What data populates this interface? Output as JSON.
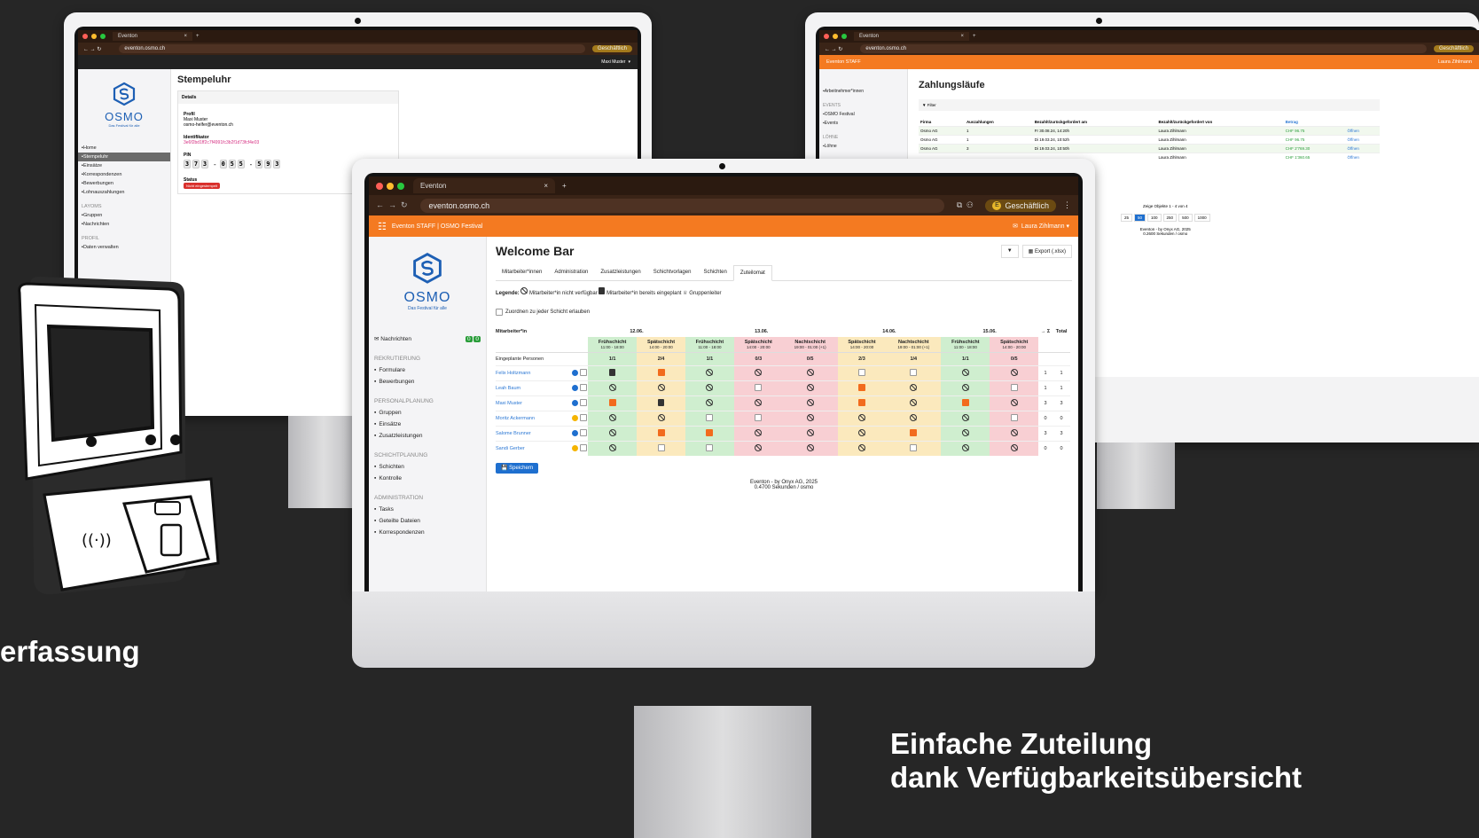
{
  "browser": {
    "tab_title": "Eventon",
    "tab_close": "×",
    "tab_new": "+",
    "url": "eventon.osmo.ch",
    "profile_label": "Geschäftlich",
    "profile_letter": "E"
  },
  "left_screen": {
    "user_menu": "Maxi Muster",
    "logo_text": "OSMO",
    "logo_tagline": "Das Festival für alle",
    "nav": [
      {
        "label": "Home",
        "active": false
      },
      {
        "label": "Stempeluhr",
        "active": true
      },
      {
        "label": "Einsätze",
        "active": false
      },
      {
        "label": "Korrespondenzen",
        "active": false
      },
      {
        "label": "Bewerbungen",
        "active": false
      },
      {
        "label": "Lohnauszahlungen",
        "active": false
      }
    ],
    "nav_section_2": "LAYOMS",
    "nav2": [
      {
        "label": "Gruppen"
      },
      {
        "label": "Nachrichten"
      }
    ],
    "nav_section_3": "PROFIL",
    "nav3": [
      {
        "label": "Daten verwalten"
      }
    ],
    "page_title": "Stempeluhr",
    "card_header": "Details",
    "profil_label": "Profil",
    "profil_name": "Maxi Muster",
    "profil_email": "osmo-helfer@eventon.ch",
    "ident_label": "Identifikator",
    "ident_value": "3e6f2bd1ff2c7f4991fc3b2f1d73fcf4e03",
    "pin_label": "PIN",
    "pin_groups": [
      [
        "3",
        "7",
        "3"
      ],
      [
        "0",
        "5",
        "5"
      ],
      [
        "5",
        "9",
        "3"
      ]
    ],
    "pin_sep": "-",
    "status_label": "Status",
    "status_badge": "Nicht eingestempelt"
  },
  "right_screen": {
    "app_title": "Eventon STAFF",
    "user_menu": "Laura Zihlmann",
    "nav": [
      {
        "label": "Arbeitnehmer*innen"
      }
    ],
    "nav_section_events": "EVENTS",
    "nav_events": [
      {
        "label": "OSMO Festival"
      },
      {
        "label": "Events"
      }
    ],
    "nav_section_lohn": "LÖHNE",
    "nav_lohn": [
      {
        "label": "Löhne"
      }
    ],
    "page_title": "Zahlungsläufe",
    "filter_label": "Filter",
    "table_headers": [
      "Firma",
      "Auszahlungen",
      "Bezahlt/zurückgefordert am",
      "Bezahlt/zurückgefordert von",
      "Betrag",
      ""
    ],
    "rows": [
      {
        "firma": "Osmo AG",
        "count": "1",
        "date": "Fr 30.08.24, 14:20h",
        "by": "Laura Zihlmann",
        "amount": "CHF 96.75",
        "action": "Öffnen"
      },
      {
        "firma": "Osmo AG",
        "count": "1",
        "date": "Di 19.03.24, 10:52h",
        "by": "Laura Zihlmann",
        "amount": "CHF 96.75",
        "action": "Öffnen"
      },
      {
        "firma": "Osmo AG",
        "count": "3",
        "date": "Di 19.03.24, 10:50h",
        "by": "Laura Zihlmann",
        "amount": "CHF 2'769.30",
        "action": "Öffnen"
      },
      {
        "firma": "",
        "count": "",
        "date": "",
        "by": "Laura Zihlmann",
        "amount": "CHF 1'360.65",
        "action": "Öffnen"
      }
    ],
    "pagination_info": "Zeige Objekte 1 - 4 von 4",
    "page_sizes": [
      "25",
      "50",
      "100",
      "250",
      "500",
      "1000"
    ],
    "footer_1": "Eventon - by Onyx AG, 2025",
    "footer_2": "0.2600 Sekunden / osmo"
  },
  "center_screen": {
    "app_title": "Eventon STAFF | OSMO Festival",
    "user_menu": "Laura Zihlmann",
    "logo_text": "OSMO",
    "logo_tagline": "Das Festival für alle",
    "nav_top": {
      "label": "Nachrichten",
      "badge_1": "0",
      "badge_2": "0"
    },
    "sections": [
      {
        "title": "REKRUTIERUNG",
        "items": [
          "Formulare",
          "Bewerbungen"
        ]
      },
      {
        "title": "PERSONALPLANUNG",
        "items": [
          "Gruppen",
          "Einsätze",
          "Zusatzleistungen"
        ]
      },
      {
        "title": "SCHICHTPLANUNG",
        "items": [
          "Schichten",
          "Kontrolle"
        ]
      },
      {
        "title": "ADMINISTRATION",
        "items": [
          "Tasks",
          "Geteilte Dateien",
          "Korrespondenzen"
        ]
      }
    ],
    "page_title": "Welcome Bar",
    "export_label": "Export (.xlsx)",
    "tabs": [
      {
        "label": "Mitarbeiter*innen",
        "active": false
      },
      {
        "label": "Administration",
        "active": false
      },
      {
        "label": "Zusatzleistungen",
        "active": false
      },
      {
        "label": "Schichtvorlagen",
        "active": false
      },
      {
        "label": "Schichten",
        "active": false
      },
      {
        "label": "Zuteilomat",
        "active": true
      }
    ],
    "legend_title": "Legende:",
    "legend_na": "Mitarbeiter*in nicht verfügbar",
    "legend_plan": "Mitarbeiter*in bereits eingeplant",
    "legend_lead": "Gruppenleiter",
    "allow_label": "Zuordnen zu jeder Schicht erlauben",
    "col_person": "Mitarbeiter*in",
    "col_sum": "→ Σ",
    "col_total": "Total",
    "dates": [
      {
        "label": "12.06.",
        "span": 2
      },
      {
        "label": "13.06.",
        "span": 3
      },
      {
        "label": "14.06.",
        "span": 2
      },
      {
        "label": "15.06.",
        "span": 2
      }
    ],
    "shifts": [
      {
        "name": "Frühschicht",
        "time": "11:00 - 18:00",
        "color": "g",
        "planned": "1/1"
      },
      {
        "name": "Spätschicht",
        "time": "14:00 - 20:00",
        "color": "y",
        "planned": "2/4"
      },
      {
        "name": "Frühschicht",
        "time": "11:00 - 18:00",
        "color": "g",
        "planned": "1/1"
      },
      {
        "name": "Spätschicht",
        "time": "14:00 - 20:00",
        "color": "r",
        "planned": "0/3"
      },
      {
        "name": "Nachtschicht",
        "time": "19:00 - 01:00 (+1)",
        "color": "r",
        "planned": "0/5"
      },
      {
        "name": "Spätschicht",
        "time": "14:00 - 20:00",
        "color": "y",
        "planned": "2/3"
      },
      {
        "name": "Nachtschicht",
        "time": "19:00 - 01:00 (+1)",
        "color": "y",
        "planned": "1/4"
      },
      {
        "name": "Frühschicht",
        "time": "11:00 - 18:00",
        "color": "g",
        "planned": "1/1"
      },
      {
        "name": "Spätschicht",
        "time": "14:00 - 20:00",
        "color": "r",
        "planned": "0/5"
      }
    ],
    "planned_label": "Eingeplante Personen",
    "people": [
      {
        "name": "Felix Holtzmann",
        "dot": "b",
        "cells": [
          "plan",
          "chk",
          "na",
          "na",
          "na",
          "box",
          "box",
          "na",
          "na"
        ],
        "sum": "1",
        "total": "1"
      },
      {
        "name": "Leah Baum",
        "dot": "b",
        "cells": [
          "na",
          "na",
          "na",
          "box",
          "na",
          "chk",
          "na",
          "na",
          "box"
        ],
        "sum": "1",
        "total": "1"
      },
      {
        "name": "Maxi Muster",
        "dot": "b",
        "cells": [
          "chk",
          "plan",
          "na",
          "na",
          "na",
          "chk",
          "na",
          "chk",
          "na"
        ],
        "sum": "3",
        "total": "3"
      },
      {
        "name": "Moritz Ackermann",
        "dot": "y",
        "cells": [
          "na",
          "na",
          "box",
          "box",
          "na",
          "na",
          "na",
          "na",
          "box"
        ],
        "sum": "0",
        "total": "0"
      },
      {
        "name": "Salome Brunner",
        "dot": "b",
        "cells": [
          "na",
          "chk",
          "chk",
          "na",
          "na",
          "na",
          "chk",
          "na",
          "na"
        ],
        "sum": "3",
        "total": "3"
      },
      {
        "name": "Sandi Gerber",
        "dot": "y",
        "cells": [
          "na",
          "box",
          "box",
          "na",
          "na",
          "na",
          "box",
          "na",
          "na"
        ],
        "sum": "0",
        "total": "0"
      }
    ],
    "save_label": "Speichern",
    "footer_1": "Eventon - by Onyx AG, 2025",
    "footer_2": "0.4700 Sekunden / osmo"
  },
  "captions": {
    "left": "erfassung",
    "right_1": "Einfache Zuteilung",
    "right_2": "dank Verfügbarkeitsübersicht"
  },
  "colors": {
    "background": "#262626",
    "accent": "#f47a21",
    "brand_blue": "#1d5fb4"
  }
}
